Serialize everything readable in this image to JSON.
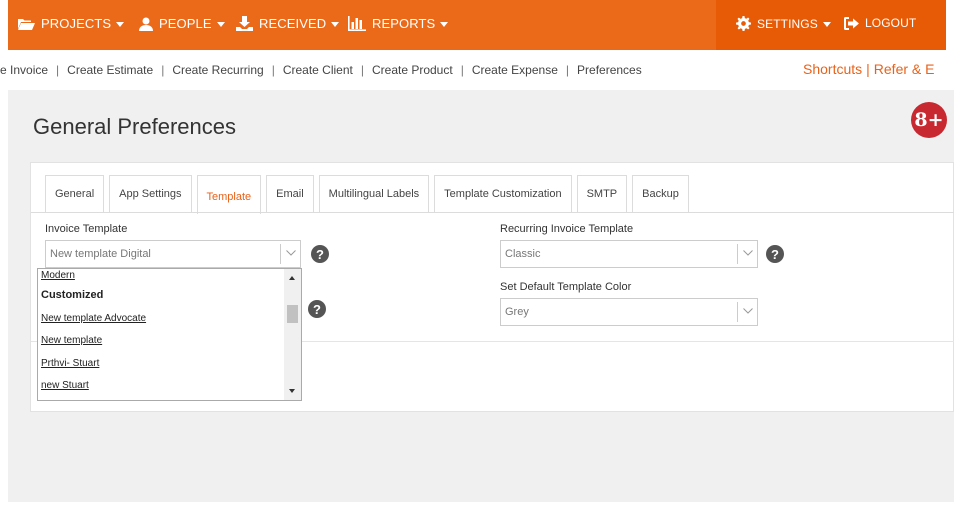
{
  "nav": {
    "projects": "PROJECTS",
    "people": "PEOPLE",
    "received": "RECEIVED",
    "reports": "REPORTS",
    "settings": "SETTINGS",
    "logout": "LOGOUT"
  },
  "shortcuts": {
    "links": [
      "e Invoice",
      "Create Estimate",
      "Create Recurring",
      "Create Client",
      "Create Product",
      "Create Expense",
      "Preferences"
    ],
    "right_shortcuts": "Shortcuts",
    "right_refer": "Refer & E"
  },
  "page": {
    "title": "General Preferences"
  },
  "gplus": "8+",
  "tabs": [
    "General",
    "App Settings",
    "Template",
    "Email",
    "Multilingual Labels",
    "Template Customization",
    "SMTP",
    "Backup"
  ],
  "active_tab": "Template",
  "form": {
    "invoice_template": {
      "label": "Invoice Template",
      "value": "New template Digital"
    },
    "recurring_template": {
      "label": "Recurring Invoice Template",
      "value": "Classic"
    },
    "template_color": {
      "label": "Set Default Template Color",
      "value": "Grey"
    }
  },
  "dropdown": {
    "items_top": "Modern",
    "group": "Customized",
    "items": [
      "New template Advocate",
      "New template",
      "Prthvi- Stuart",
      "new Stuart"
    ]
  },
  "colors": {
    "nav": "#ea6a1a",
    "nav_dark": "#e85b06",
    "accent": "#e8621a",
    "gplus": "#c8282f"
  }
}
